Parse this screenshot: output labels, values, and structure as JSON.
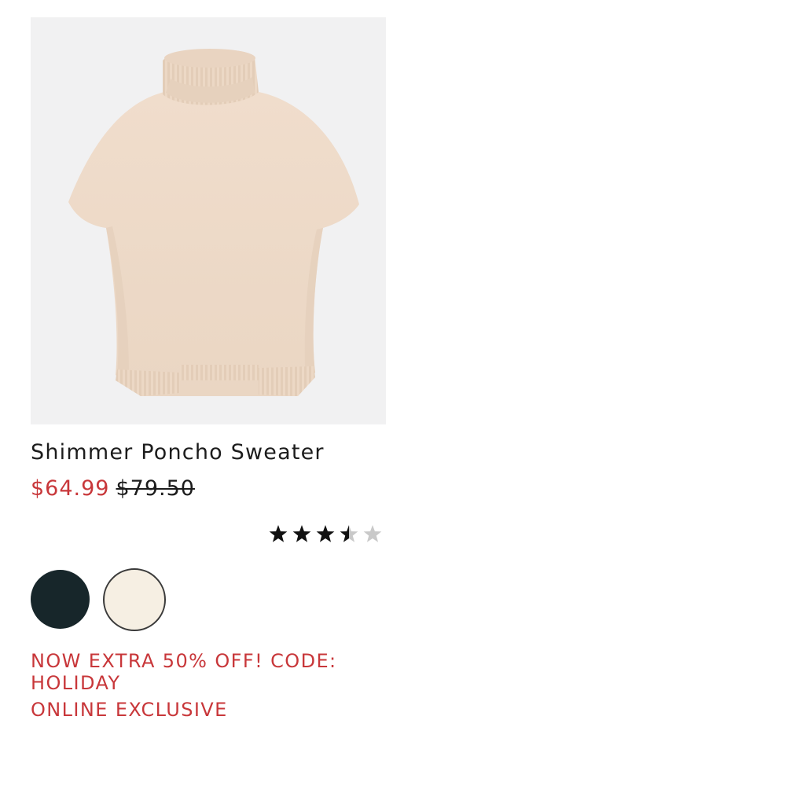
{
  "product": {
    "name": "Shimmer Poncho Sweater",
    "sale_price": "$64.99",
    "original_price": "$79.50",
    "rating": 3.5,
    "rating_max": 5,
    "image_icon": "poncho-sweater-photo",
    "swatches": [
      {
        "name": "dark",
        "color": "#17262a"
      },
      {
        "name": "cream",
        "color": "#f6efe3"
      }
    ],
    "promo_text": "NOW EXTRA 50% OFF! CODE: HOLIDAY",
    "badge_text": "ONLINE EXCLUSIVE"
  },
  "colors": {
    "accent_red": "#c8373a",
    "image_background": "#f1f1f2",
    "sweater": "#efdccb",
    "star_filled": "#111111",
    "star_empty": "#c9c9c9"
  }
}
